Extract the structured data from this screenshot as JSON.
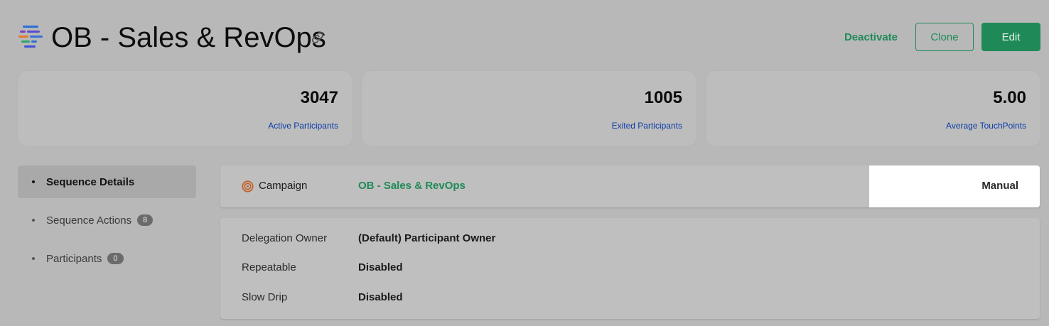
{
  "header": {
    "title": "OB - Sales & RevOps",
    "logo_icon": "sequence-logo-icon",
    "link_icon": "link-icon",
    "deactivate_label": "Deactivate",
    "clone_label": "Clone",
    "edit_label": "Edit"
  },
  "stats": [
    {
      "value": "3047",
      "label": "Active Participants"
    },
    {
      "value": "1005",
      "label": "Exited Participants"
    },
    {
      "value": "5.00",
      "label": "Average TouchPoints"
    }
  ],
  "sidebar": {
    "items": [
      {
        "label": "Sequence Details",
        "badge": null,
        "active": true
      },
      {
        "label": "Sequence Actions",
        "badge": "8",
        "active": false
      },
      {
        "label": "Participants",
        "badge": "0",
        "active": false
      }
    ]
  },
  "campaign": {
    "icon": "target-icon",
    "label": "Campaign",
    "name": "OB - Sales & RevOps",
    "mode": "Manual"
  },
  "details": [
    {
      "key": "Delegation Owner",
      "value": "(Default) Participant Owner"
    },
    {
      "key": "Repeatable",
      "value": "Disabled"
    },
    {
      "key": "Slow Drip",
      "value": "Disabled"
    }
  ],
  "colors": {
    "accent": "#1f8a57",
    "link": "#0b3ea8",
    "background": "#b8b8b8"
  }
}
